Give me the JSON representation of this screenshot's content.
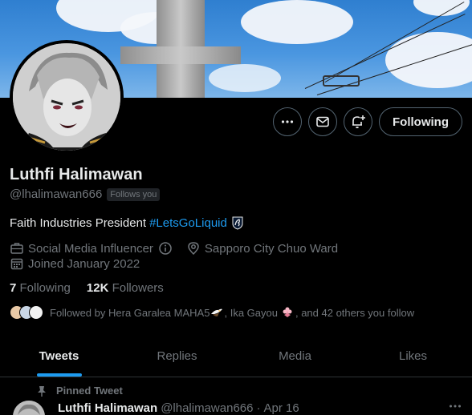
{
  "profile": {
    "name": "Luthfi Halimawan",
    "handle": "@lhalimawan666",
    "follows_you": "Follows you",
    "bio_text": "Faith Industries President",
    "bio_hashtag": "#LetsGoLiquid",
    "category": "Social Media Influencer",
    "location": "Sapporo City Chuo Ward",
    "joined": "Joined January 2022",
    "following_count": "7",
    "following_label": "Following",
    "followers_count": "12K",
    "followers_label": "Followers"
  },
  "actions": {
    "follow_label": "Following"
  },
  "followed_by": {
    "prefix": "Followed by",
    "user1": "Hera Garalea MAHA5",
    "sep": ",",
    "user2": "Ika Gayou",
    "suffix": ", and 42 others you follow"
  },
  "tabs": [
    {
      "label": "Tweets"
    },
    {
      "label": "Replies"
    },
    {
      "label": "Media"
    },
    {
      "label": "Likes"
    }
  ],
  "tweet": {
    "pinned_label": "Pinned Tweet",
    "name": "Luthfi Halimawan",
    "handle": "@lhalimawan666",
    "dot": "·",
    "date": "Apr 16"
  },
  "colors": {
    "accent": "#1d9bf0",
    "muted": "#71767b",
    "text": "#e7e9ea",
    "background": "#000000"
  }
}
